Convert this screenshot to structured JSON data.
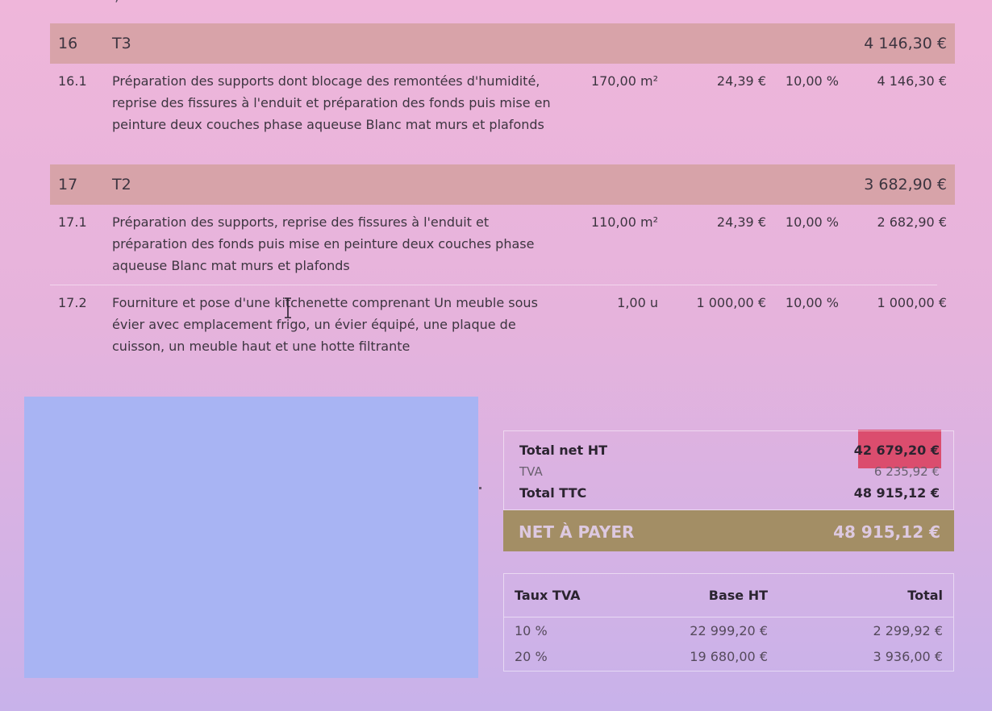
{
  "sections": [
    {
      "number": "16",
      "title": "T3",
      "amount": "4 146,30 €",
      "items": [
        {
          "number": "16.1",
          "description": "Préparation des supports dont blocage des remontées d'humidité, reprise des fissures à l'enduit et préparation des fonds puis mise en peinture deux couches phase aqueuse Blanc mat murs et plafonds",
          "quantity": "170,00 m²",
          "unit_price": "24,39 €",
          "vat": "10,00 %",
          "total": "4 146,30 €"
        }
      ]
    },
    {
      "number": "17",
      "title": "T2",
      "amount": "3 682,90 €",
      "items": [
        {
          "number": "17.1",
          "description": "Préparation des supports, reprise des fissures à l'enduit et préparation des fonds puis mise en peinture deux couches phase aqueuse Blanc mat murs et plafonds",
          "quantity": "110,00 m²",
          "unit_price": "24,39 €",
          "vat": "10,00 %",
          "total": "2 682,90 €"
        },
        {
          "number": "17.2",
          "description": "Fourniture et pose d'une kitchenette comprenant Un meuble sous évier avec emplacement frigo, un évier équipé, une plaque de cuisson, un meuble haut et une hotte filtrante",
          "quantity": "1,00 u",
          "unit_price": "1 000,00 €",
          "vat": "10,00 %",
          "total": "1 000,00 €"
        }
      ]
    }
  ],
  "totals": {
    "net_ht_label": "Total net HT",
    "net_ht_value": "42 679,20 €",
    "tva_label": "TVA",
    "tva_value": "6 235,92 €",
    "ttc_label": "Total TTC",
    "ttc_value": "48 915,12 €",
    "net_a_payer_label": "NET À PAYER",
    "net_a_payer_value": "48 915,12 €"
  },
  "vat_table": {
    "headers": [
      "Taux TVA",
      "Base HT",
      "Total"
    ],
    "rows": [
      [
        "10 %",
        "22 999,20 €",
        "2 299,92 €"
      ],
      [
        "20 %",
        "19 680,00 €",
        "3 936,00 €"
      ]
    ]
  },
  "colors": {
    "section_band": "#d4a0a0",
    "highlight": "#db4d6e",
    "net_bar": "#a38e65",
    "redacted_block": "#a8b4f3"
  },
  "icons": {
    "cursor": "text-cursor-icon"
  }
}
